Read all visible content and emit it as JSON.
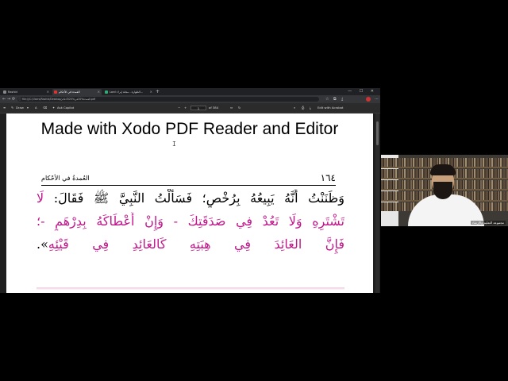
{
  "browser": {
    "tabs": [
      {
        "label": "Rashid",
        "active": false
      },
      {
        "label": "العمدة في الأحكام",
        "active": true
      },
      {
        "label": "Lord: الطهارة - مجلة إيرلا…",
        "active": false
      }
    ],
    "new_tab_glyph": "+",
    "window_controls": "— ☐ ✕",
    "nav": {
      "back": "←",
      "forward": "→",
      "reload": "⟳"
    },
    "url": "file:///C:/Users/Rashid/Desktop/العمدة%20في%20الأحكام.pdf",
    "edit_label": "Edit with Acrobat"
  },
  "pdf_toolbar": {
    "menu": "≡",
    "draw": "Draw",
    "ask_copilot": "Ask Copilot",
    "zoom_out": "−",
    "zoom_in": "+",
    "page": "of 384"
  },
  "document": {
    "watermark": "Made with Xodo PDF Reader and Editor",
    "cursor": "I",
    "page_number": "١٦٤",
    "book_title": "العُمدةُ في الأحْكام",
    "lines": [
      {
        "segments": [
          {
            "t": "وَظَنَنْتُ أَنَّهُ يَبِيعُهُ بِرُخْصٍ؛ فَسَأَلْتُ النَّبِيَّ ﷺ فَقَالَ: ",
            "m": false
          },
          {
            "t": "لَا",
            "m": true
          }
        ]
      },
      {
        "segments": [
          {
            "t": "تَشْتَرِهِ وَلَا تَعُدْ فِي صَدَقَتِكَ - وَإِنْ أَعْطَاكَهُ بِدِرْهَمٍ -؛",
            "m": true
          }
        ]
      },
      {
        "segments": [
          {
            "t": "فَإِنَّ العَائِدَ فِي هِبَتِهِ كَالعَائِدِ فِي قَيْئِهِ",
            "m": true
          },
          {
            "t": "».",
            "m": false
          }
        ]
      }
    ]
  },
  "webcam": {
    "label": "مجموعة التعليم والإرشاد"
  },
  "colors": {
    "highlight": "#c0168a",
    "tab_active": "#35363a",
    "toolbar": "#2b2b2b"
  }
}
